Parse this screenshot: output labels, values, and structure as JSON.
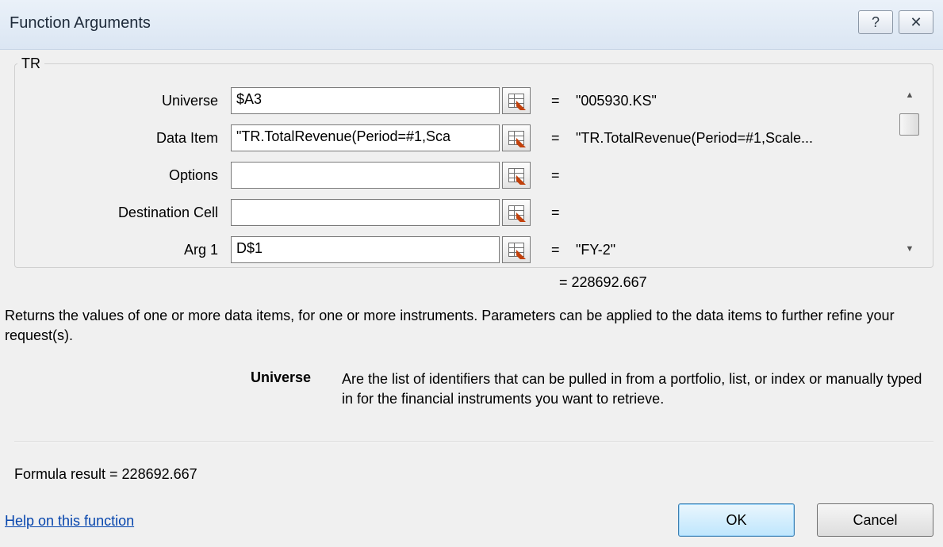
{
  "window": {
    "title": "Function Arguments",
    "help_glyph": "?",
    "close_glyph": "✕"
  },
  "group": {
    "label": "TR"
  },
  "args": [
    {
      "label": "Universe",
      "value": "$A3",
      "result": "\"005930.KS\""
    },
    {
      "label": "Data Item",
      "value": "\"TR.TotalRevenue(Period=#1,Sca",
      "result": "\"TR.TotalRevenue(Period=#1,Scale..."
    },
    {
      "label": "Options",
      "value": "",
      "result": ""
    },
    {
      "label": "Destination Cell",
      "value": "",
      "result": ""
    },
    {
      "label": "Arg 1",
      "value": "D$1",
      "result": "\"FY-2\""
    }
  ],
  "equals": "=",
  "function_result": "= 228692.667",
  "description": "Returns the values of one or more data items, for one or more instruments. Parameters can be applied to the data items to further refine your request(s).",
  "parameter": {
    "name": "Universe",
    "description": "Are the list of identifiers that can be pulled in from a portfolio, list, or index or manually typed in for the financial instruments you want to retrieve."
  },
  "formula_result": "Formula result =   228692.667",
  "help_link": "Help on this function",
  "buttons": {
    "ok": "OK",
    "cancel": "Cancel"
  },
  "scrollbar": {
    "up_glyph": "▲",
    "down_glyph": "▼"
  }
}
